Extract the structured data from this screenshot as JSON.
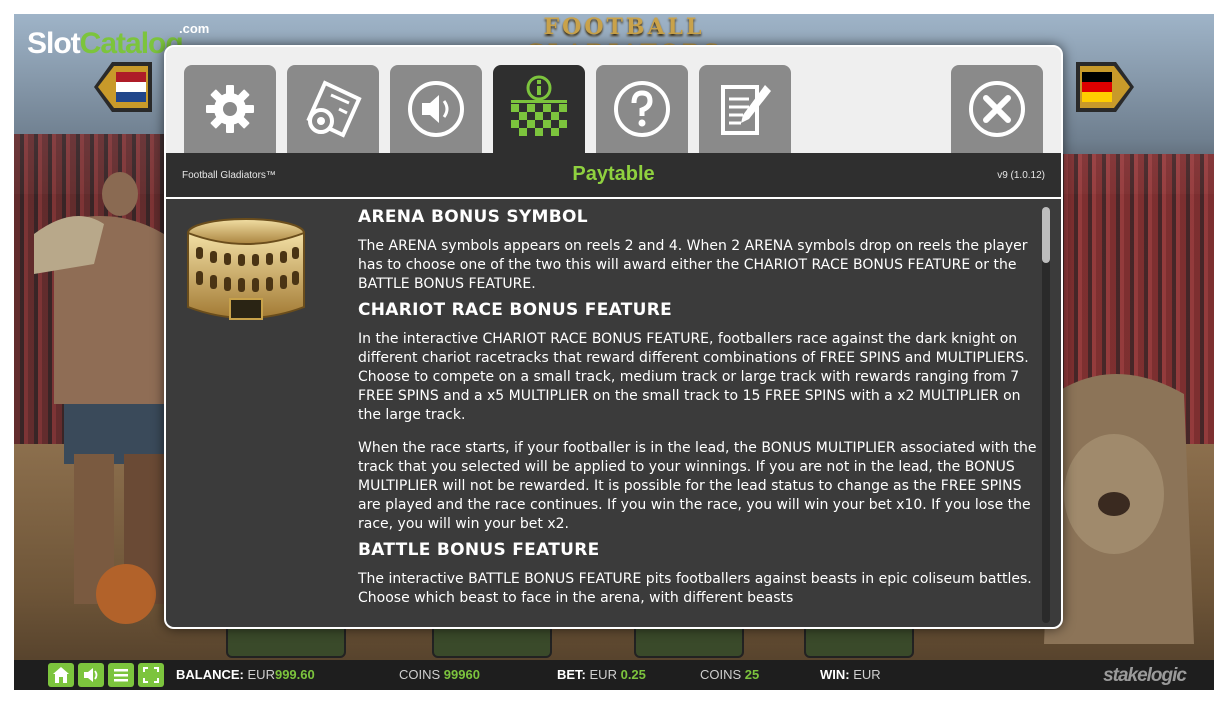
{
  "watermark": {
    "slot": "Slot",
    "catalog": "Catalog",
    "com": ".com"
  },
  "background": {
    "game_logo": "FOOTBALL GLADIATORS"
  },
  "tabs": [
    {
      "name": "settings",
      "icon": "gear-icon"
    },
    {
      "name": "autoplay-settings",
      "icon": "settings-document-icon"
    },
    {
      "name": "sound",
      "icon": "speaker-icon"
    },
    {
      "name": "paytable",
      "icon": "info-grid-icon",
      "active": true
    },
    {
      "name": "help",
      "icon": "question-icon"
    },
    {
      "name": "rules",
      "icon": "notepad-pen-icon"
    },
    {
      "name": "close",
      "icon": "close-icon"
    }
  ],
  "header": {
    "game_name": "Football Gladiators™",
    "title": "Paytable",
    "version": "v9 (1.0.12)"
  },
  "content": {
    "sections": [
      {
        "heading": "ARENA BONUS SYMBOL",
        "paragraphs": [
          "The ARENA symbols appears on reels 2 and 4. When 2 ARENA symbols drop on reels the player has to choose one of the two this will award either the CHARIOT RACE BONUS FEATURE or the BATTLE BONUS FEATURE."
        ]
      },
      {
        "heading": "CHARIOT RACE BONUS FEATURE",
        "paragraphs": [
          "In the interactive CHARIOT RACE BONUS FEATURE, footballers race against the dark knight on different chariot racetracks that reward different combinations of FREE SPINS and MULTIPLIERS. Choose to compete on a small track, medium track or large track with rewards ranging from 7 FREE SPINS and a x5 MULTIPLIER on the small track to 15 FREE SPINS with a x2 MULTIPLIER on the large track.",
          "When the race starts, if your footballer is in the lead, the BONUS MULTIPLIER associated with the track that you selected will be applied to your winnings. If you are not in the lead, the BONUS MULTIPLIER will not be rewarded. It is possible for the lead status to change as the FREE SPINS are played and the race continues. If you win the race, you will win your bet x10. If you lose the race, you will win your bet x2."
        ]
      },
      {
        "heading": "BATTLE BONUS FEATURE",
        "paragraphs": [
          "The interactive BATTLE BONUS FEATURE pits footballers against beasts in epic coliseum battles. Choose which beast to face in the arena, with different beasts"
        ]
      }
    ],
    "scroll_position": 0.0
  },
  "status_bar": {
    "buttons": [
      {
        "name": "home",
        "icon": "home-icon"
      },
      {
        "name": "sound",
        "icon": "speaker-icon"
      },
      {
        "name": "menu",
        "icon": "menu-icon"
      },
      {
        "name": "fullscreen",
        "icon": "fullscreen-icon"
      }
    ],
    "balance_label": "BALANCE:",
    "balance_currency": "EUR",
    "balance_value": "999.60",
    "coins_label": "COINS",
    "coins_value": "99960",
    "bet_label": "BET:",
    "bet_currency": "EUR",
    "bet_value": "0.25",
    "coin_value_label": "COINS",
    "coin_value": "25",
    "win_label": "WIN:",
    "win_currency": "EUR",
    "brand": "stakelogic"
  },
  "colors": {
    "accent": "#7cc43d",
    "panel": "#3b3b3b",
    "tab": "#8a8a8a",
    "tab_active": "#2f2f2f"
  }
}
